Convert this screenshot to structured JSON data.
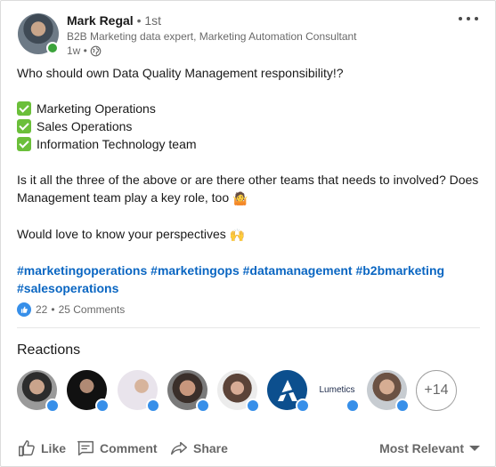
{
  "post": {
    "author": {
      "name": "Mark Regal",
      "degree": "• 1st",
      "headline": "B2B Marketing data expert, Marketing Automation Consultant",
      "time": "1w •"
    },
    "body": {
      "question": "Who should own Data Quality Management responsibility!?",
      "options": [
        "Marketing Operations",
        "Sales Operations",
        "Information Technology team"
      ],
      "paragraph_1a": "Is it all the three of the above or are there other teams that needs to involved? Does",
      "paragraph_1b": "Management team play a key role, too",
      "paragraph_2": "Would love to know your perspectives",
      "hashtags_line_1": [
        "#marketingoperations",
        "#marketingops",
        "#datamanagement",
        "#b2bmarketing"
      ],
      "hashtags_line_2": [
        "#salesoperations"
      ]
    },
    "emoji": {
      "shrug": "🤷",
      "raised_hands": "🙌"
    },
    "social": {
      "reaction_count": "22",
      "separator": "•",
      "comments": "25 Comments"
    }
  },
  "reactions": {
    "title": "Reactions",
    "company_logo_text": "Lumetics",
    "more_count": "+14"
  },
  "actions": {
    "like": "Like",
    "comment": "Comment",
    "share": "Share",
    "sort": "Most Relevant"
  },
  "colors": {
    "link": "#0a66c2",
    "like_blue": "#378fe9",
    "presence": "#3ba33b",
    "check": "#6bbf3a"
  },
  "icons": [
    "more-icon",
    "globe-icon",
    "check-icon",
    "like-icon",
    "comment-icon",
    "share-icon",
    "caret-down-icon"
  ]
}
